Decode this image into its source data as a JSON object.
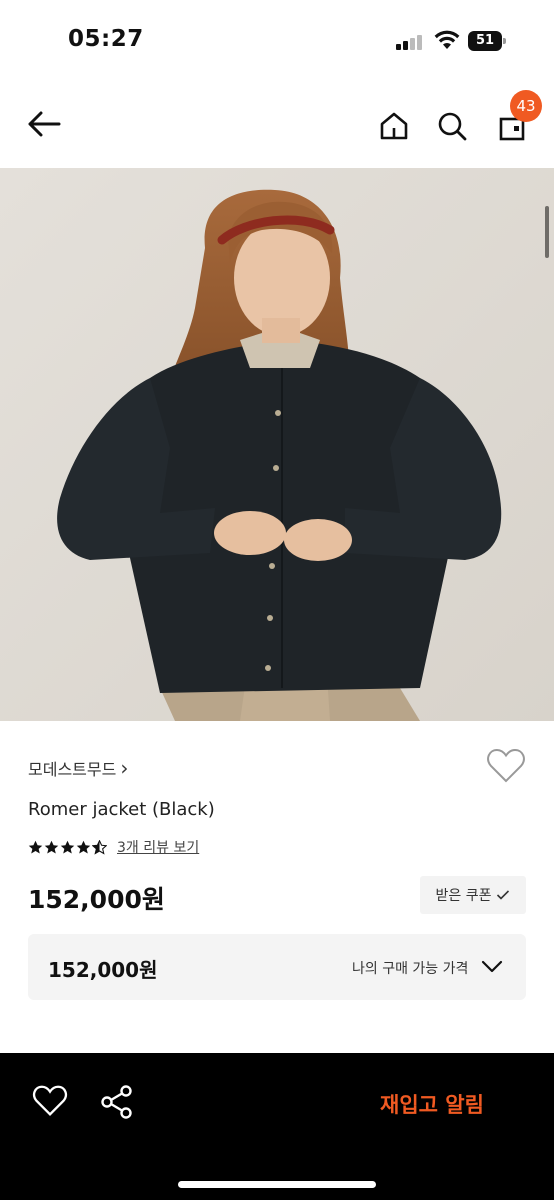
{
  "status_bar": {
    "time": "05:27",
    "battery": "51"
  },
  "nav": {
    "back_icon": "arrow-left-icon",
    "home_icon": "home-icon",
    "search_icon": "search-icon",
    "cart_icon": "shopping-bag-icon",
    "cart_count": "43"
  },
  "product": {
    "image_alt": "product-photo",
    "brand": "모데스트무드",
    "brand_chevron": "›",
    "name": "Romer jacket (Black)",
    "rating": 4.5,
    "review_link": "3개 리뷰 보기",
    "price": "152,000원",
    "coupon_label": "받은 쿠폰",
    "my_price": "152,000원",
    "my_price_label": "나의 구매 가능 가격"
  },
  "bottom_bar": {
    "restock_label": "재입고 알림"
  },
  "colors": {
    "accent": "#f05a22",
    "bottom_bar": "#000000",
    "panel": "#f4f4f4"
  }
}
